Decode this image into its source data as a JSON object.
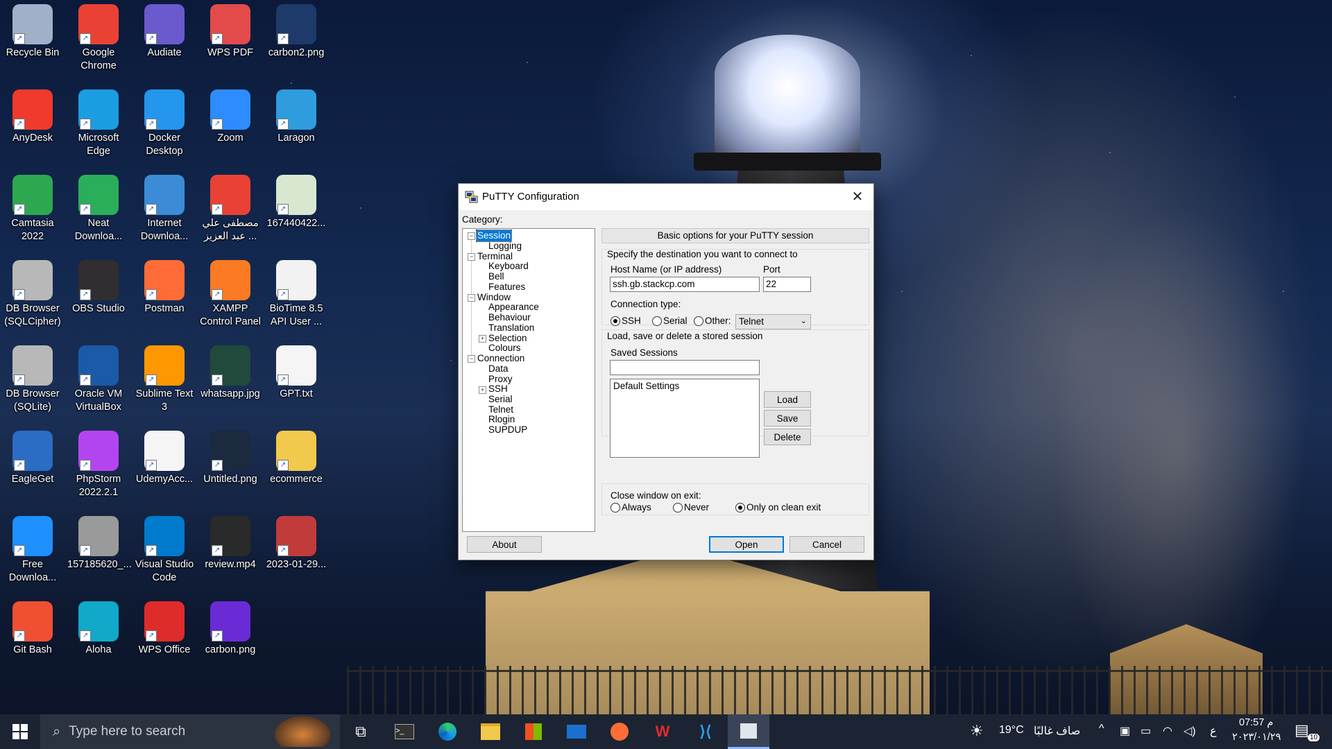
{
  "desktop_icons": [
    {
      "label": "Recycle Bin",
      "icon": "recycle-bin-icon",
      "color": "#9fb0c8"
    },
    {
      "label": "Google Chrome",
      "icon": "chrome-icon",
      "color": "#e94235"
    },
    {
      "label": "Audiate",
      "icon": "audiate-icon",
      "color": "#6a5acd"
    },
    {
      "label": "WPS PDF",
      "icon": "wps-pdf-icon",
      "color": "#e34b4b"
    },
    {
      "label": "carbon2.png",
      "icon": "image-file-icon",
      "color": "#1e3a6a"
    },
    {
      "label": "AnyDesk",
      "icon": "anydesk-icon",
      "color": "#ef3a2d"
    },
    {
      "label": "Microsoft Edge",
      "icon": "edge-icon",
      "color": "#1b9de2"
    },
    {
      "label": "Docker Desktop",
      "icon": "docker-icon",
      "color": "#2496ed"
    },
    {
      "label": "Zoom",
      "icon": "zoom-icon",
      "color": "#2d8cff"
    },
    {
      "label": "Laragon",
      "icon": "laragon-icon",
      "color": "#2f9cde"
    },
    {
      "label": "Camtasia 2022",
      "icon": "camtasia-icon",
      "color": "#2ea84f"
    },
    {
      "label": "Neat Downloa...",
      "icon": "neat-download-icon",
      "color": "#2bae5a"
    },
    {
      "label": "Internet Downloa...",
      "icon": "idm-icon",
      "color": "#3b8bd6"
    },
    {
      "label": "مصطفى علي عبد العزيز ...",
      "icon": "chrome-profile-icon",
      "color": "#e94235"
    },
    {
      "label": "167440422...",
      "icon": "image-file-icon",
      "color": "#d8e8d0"
    },
    {
      "label": "DB Browser (SQLCipher)",
      "icon": "db-browser-icon",
      "color": "#b8b8b8"
    },
    {
      "label": "OBS Studio",
      "icon": "obs-icon",
      "color": "#302e31"
    },
    {
      "label": "Postman",
      "icon": "postman-icon",
      "color": "#ff6c37"
    },
    {
      "label": "XAMPP Control Panel",
      "icon": "xampp-icon",
      "color": "#fb7a24"
    },
    {
      "label": "BioTime 8.5 API User ...",
      "icon": "pdf-file-icon",
      "color": "#f2f2f2"
    },
    {
      "label": "DB Browser (SQLite)",
      "icon": "db-browser-icon",
      "color": "#b8b8b8"
    },
    {
      "label": "Oracle VM VirtualBox",
      "icon": "virtualbox-icon",
      "color": "#1b5aa6"
    },
    {
      "label": "Sublime Text 3",
      "icon": "sublime-icon",
      "color": "#ff9800"
    },
    {
      "label": "whatsapp.jpg",
      "icon": "image-file-icon",
      "color": "#214a3c"
    },
    {
      "label": "GPT.txt",
      "icon": "text-file-icon",
      "color": "#f5f5f5"
    },
    {
      "label": "EagleGet",
      "icon": "eagleget-icon",
      "color": "#2b6cc4"
    },
    {
      "label": "PhpStorm 2022.2.1",
      "icon": "phpstorm-icon",
      "color": "#b345f1"
    },
    {
      "label": "UdemyAcc...",
      "icon": "text-file-icon",
      "color": "#f5f5f5"
    },
    {
      "label": "Untitled.png",
      "icon": "image-file-icon",
      "color": "#1c2a40"
    },
    {
      "label": "ecommerce",
      "icon": "folder-icon",
      "color": "#f2c94c"
    },
    {
      "label": "Free Downloa...",
      "icon": "free-download-manager-icon",
      "color": "#1e90ff"
    },
    {
      "label": "157185620_...",
      "icon": "image-file-icon",
      "color": "#9a9a9a"
    },
    {
      "label": "Visual Studio Code",
      "icon": "vscode-icon",
      "color": "#007acc"
    },
    {
      "label": "review.mp4",
      "icon": "video-file-icon",
      "color": "#2a2a2a"
    },
    {
      "label": "2023-01-29...",
      "icon": "image-file-icon",
      "color": "#c23b3b"
    },
    {
      "label": "Git Bash",
      "icon": "git-bash-icon",
      "color": "#f05032"
    },
    {
      "label": "Aloha",
      "icon": "aloha-icon",
      "color": "#11a8c9"
    },
    {
      "label": "WPS Office",
      "icon": "wps-office-icon",
      "color": "#e02b2b"
    },
    {
      "label": "carbon.png",
      "icon": "image-file-icon",
      "color": "#6a2bd6"
    }
  ],
  "putty": {
    "title": "PuTTY Configuration",
    "category_label": "Category:",
    "tree": {
      "session": "Session",
      "logging": "Logging",
      "terminal": "Terminal",
      "keyboard": "Keyboard",
      "bell": "Bell",
      "features": "Features",
      "window": "Window",
      "appearance": "Appearance",
      "behaviour": "Behaviour",
      "translation": "Translation",
      "selection": "Selection",
      "colours": "Colours",
      "connection": "Connection",
      "data": "Data",
      "proxy": "Proxy",
      "ssh": "SSH",
      "serial": "Serial",
      "telnet": "Telnet",
      "rlogin": "Rlogin",
      "supdup": "SUPDUP"
    },
    "panel_header": "Basic options for your PuTTY session",
    "destination_label": "Specify the destination you want to connect to",
    "host_label": "Host Name (or IP address)",
    "host_value": "ssh.gb.stackcp.com",
    "port_label": "Port",
    "port_value": "22",
    "conn_type_label": "Connection type:",
    "conn_ssh": "SSH",
    "conn_serial": "Serial",
    "conn_other": "Other:",
    "other_select": "Telnet",
    "sessions_group_label": "Load, save or delete a stored session",
    "saved_sessions_label": "Saved Sessions",
    "saved_sessions_value": "",
    "sessions_list": [
      "Default Settings"
    ],
    "load": "Load",
    "save": "Save",
    "delete": "Delete",
    "close_exit_label": "Close window on exit:",
    "exit_always": "Always",
    "exit_never": "Never",
    "exit_clean": "Only on clean exit",
    "about": "About",
    "open": "Open",
    "cancel": "Cancel"
  },
  "taskbar": {
    "search_placeholder": "Type here to search",
    "weather_temp": "19°C",
    "weather_text": "صاف غالبًا",
    "lang": "ع",
    "time": "07:57 م",
    "date": "٢٠٢٣/٠١/٢٩",
    "notification_count": "10"
  }
}
